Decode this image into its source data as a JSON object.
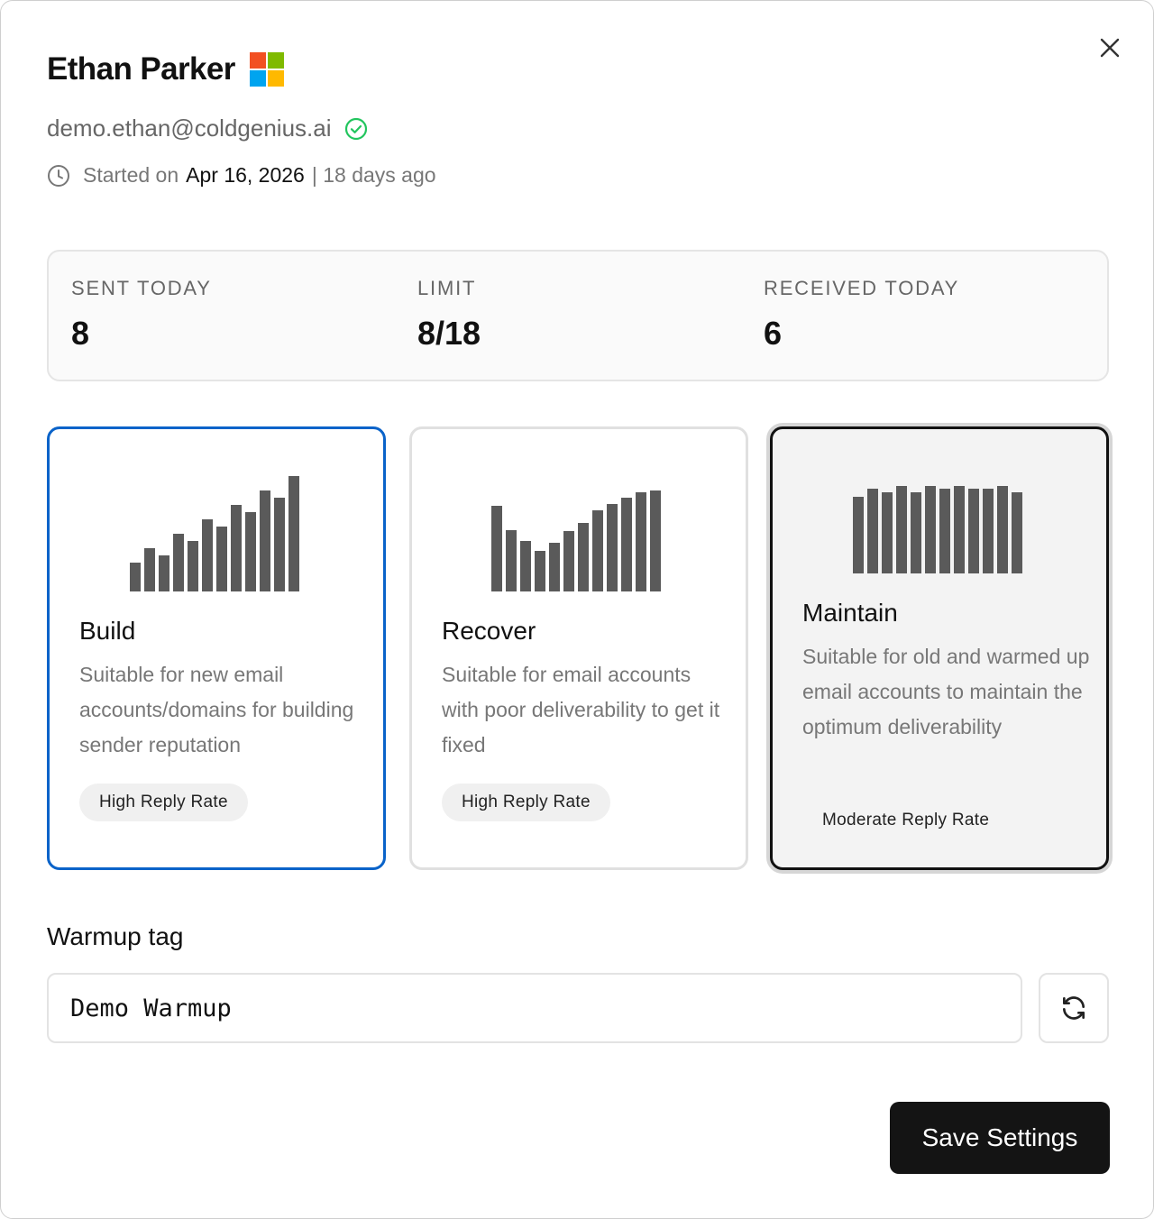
{
  "header": {
    "name": "Ethan Parker",
    "provider_logo": "microsoft-logo",
    "email": "demo.ethan@coldgenius.ai",
    "email_status_icon": "check-circle-icon",
    "email_status_color": "#22c55e",
    "started_prefix": "Started on",
    "started_date": "Apr 16, 2026",
    "started_suffix": "| 18 days ago",
    "close_icon": "close-icon"
  },
  "stats": {
    "sent_today": {
      "label": "SENT TODAY",
      "value": "8"
    },
    "limit": {
      "label": "LIMIT",
      "value": "8/18"
    },
    "received_today": {
      "label": "RECEIVED TODAY",
      "value": "6"
    }
  },
  "modes": [
    {
      "key": "build",
      "title": "Build",
      "description": "Suitable for new email accounts/domains for building sender reputation",
      "badge": "High Reply Rate",
      "selected": true,
      "trend_levels": [
        0.25,
        0.375,
        0.3125,
        0.5,
        0.4375,
        0.625,
        0.5625,
        0.75,
        0.6875,
        0.875,
        0.8125,
        1.0
      ]
    },
    {
      "key": "recover",
      "title": "Recover",
      "description": "Suitable for email accounts with poor deliverability to get it fixed",
      "badge": "High Reply Rate",
      "selected": false,
      "trend_levels": [
        0.85,
        0.61,
        0.5,
        0.4,
        0.48,
        0.6,
        0.68,
        0.8,
        0.87,
        0.93,
        0.98,
        1.0
      ]
    },
    {
      "key": "maintain",
      "title": "Maintain",
      "description": "Suitable for old and warmed up email accounts to maintain the optimum deliverability",
      "badge": "Moderate Reply Rate",
      "selected": false,
      "trend_levels": [
        0.88,
        0.97,
        0.93,
        1.0,
        0.93,
        1.0,
        0.97,
        1.0,
        0.97,
        0.97,
        1.0,
        0.93
      ]
    }
  ],
  "warmup": {
    "label": "Warmup tag",
    "value": "Demo Warmup",
    "refresh_icon": "refresh-icon"
  },
  "actions": {
    "save_label": "Save Settings"
  },
  "colors": {
    "accent": "#0a63c9",
    "bar": "#5a5a5a",
    "primary_button": "#141414",
    "ms_red": "#f25022",
    "ms_green": "#7fba00",
    "ms_blue": "#00a4ef",
    "ms_yellow": "#ffb900"
  }
}
